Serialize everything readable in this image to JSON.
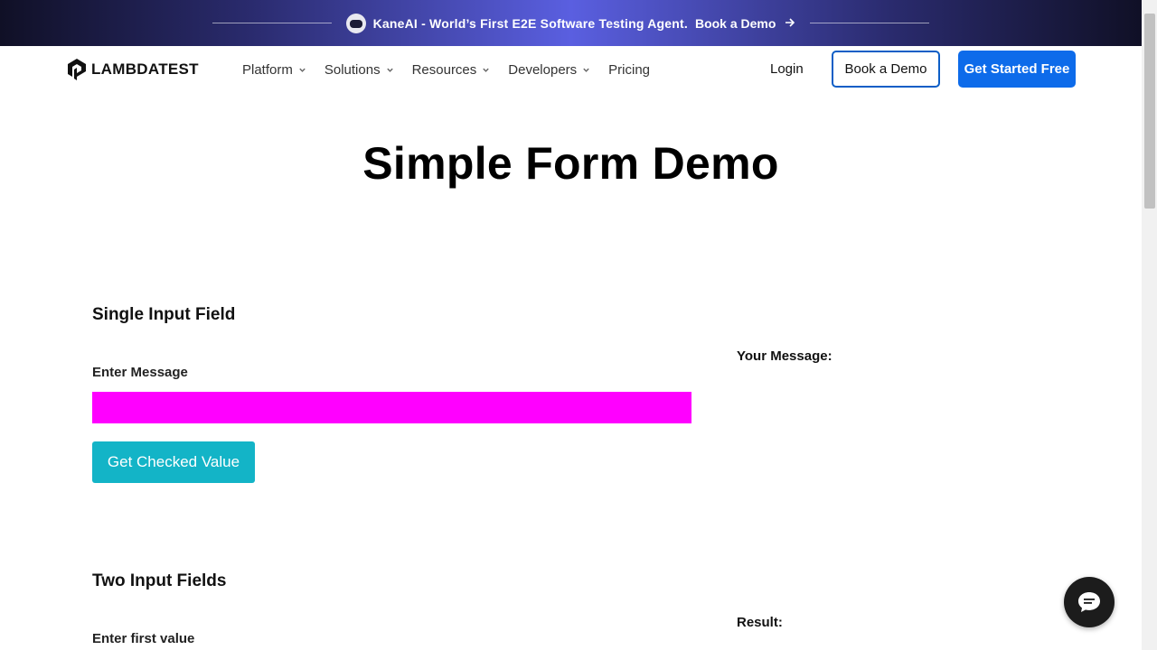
{
  "banner": {
    "message": "KaneAI - World’s First E2E Software Testing Agent.",
    "cta": "Book a Demo"
  },
  "nav": {
    "logo_text": "LAMBDATEST",
    "menu": [
      {
        "label": "Platform",
        "dropdown": true
      },
      {
        "label": "Solutions",
        "dropdown": true
      },
      {
        "label": "Resources",
        "dropdown": true
      },
      {
        "label": "Developers",
        "dropdown": true
      },
      {
        "label": "Pricing",
        "dropdown": false
      }
    ],
    "login": "Login",
    "book_demo": "Book a Demo",
    "get_started": "Get Started Free"
  },
  "page": {
    "title": "Simple Form Demo"
  },
  "single_input": {
    "section_title": "Single Input Field",
    "field_label": "Enter Message",
    "field_value": "",
    "button_label": "Get Checked Value",
    "result_label": "Your Message:"
  },
  "two_inputs": {
    "section_title": "Two Input Fields",
    "first_label": "Enter first value",
    "result_label": "Result:"
  },
  "colors": {
    "input_highlight": "#ff00ff",
    "primary_button": "#13b4c7",
    "brand_blue": "#0d6bea"
  },
  "icons": {
    "chat": "chat-bubble-icon",
    "banner_arrow": "arrow-right-icon",
    "chevron": "chevron-down-icon"
  }
}
